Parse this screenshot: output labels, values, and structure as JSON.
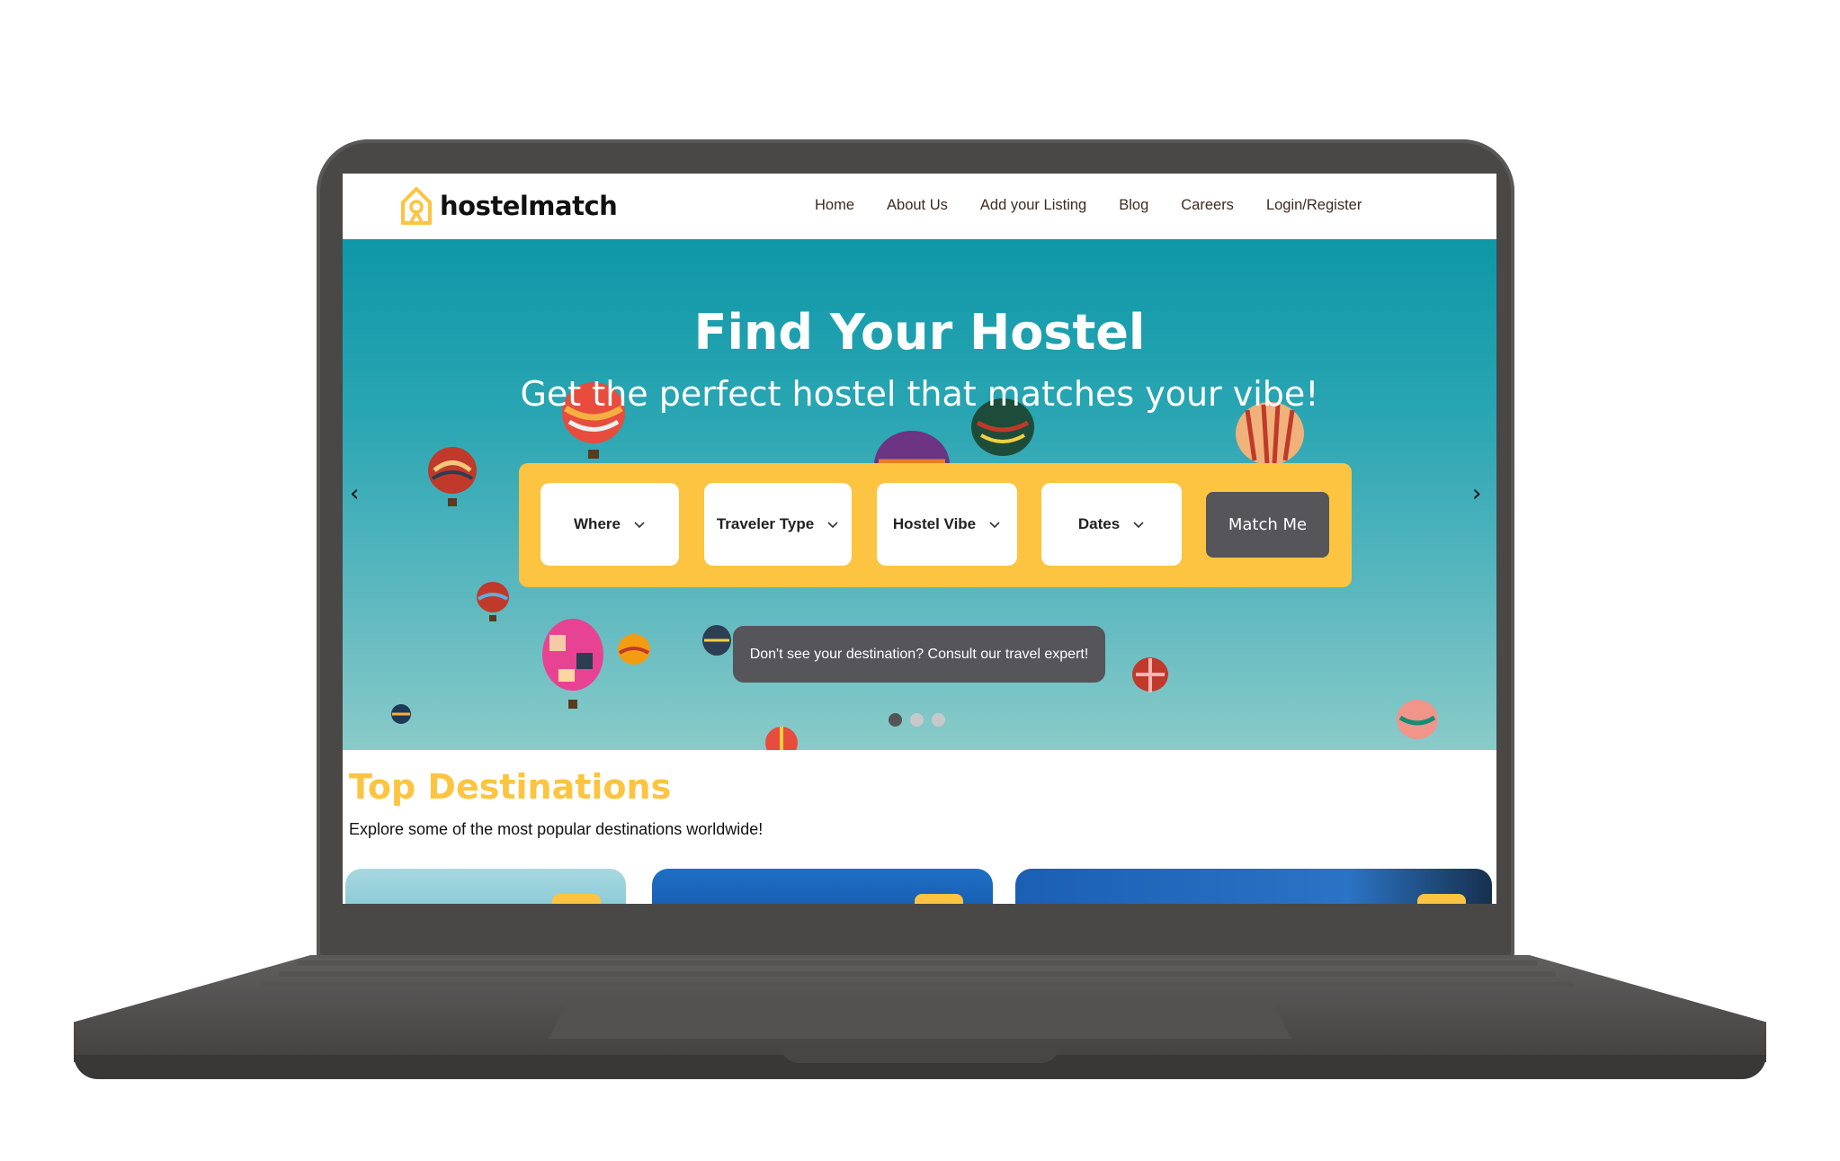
{
  "brand": {
    "name": "hostelmatch"
  },
  "nav": [
    "Home",
    "About Us",
    "Add your Listing",
    "Blog",
    "Careers",
    "Login/Register"
  ],
  "hero": {
    "title": "Find Your Hostel",
    "subtitle": "Get the perfect hostel that matches your vibe!",
    "prev_arrow": "‹",
    "next_arrow": "›",
    "slides": 3,
    "active_slide": 1
  },
  "search": {
    "fields": [
      "Where",
      "Traveler Type",
      "Hostel Vibe",
      "Dates"
    ],
    "submit": "Match Me"
  },
  "consult": "Don't see your destination? Consult our travel expert!",
  "destinations": {
    "title": "Top Destinations",
    "subtitle": "Explore some of the most popular destinations worldwide!"
  },
  "colors": {
    "accent": "#fcc440",
    "button": "#55555a",
    "hero_top": "#0e97a8",
    "hero_bottom": "#8acbc9",
    "laptop": "#4a4847",
    "nav_text": "#3d2b1f"
  }
}
